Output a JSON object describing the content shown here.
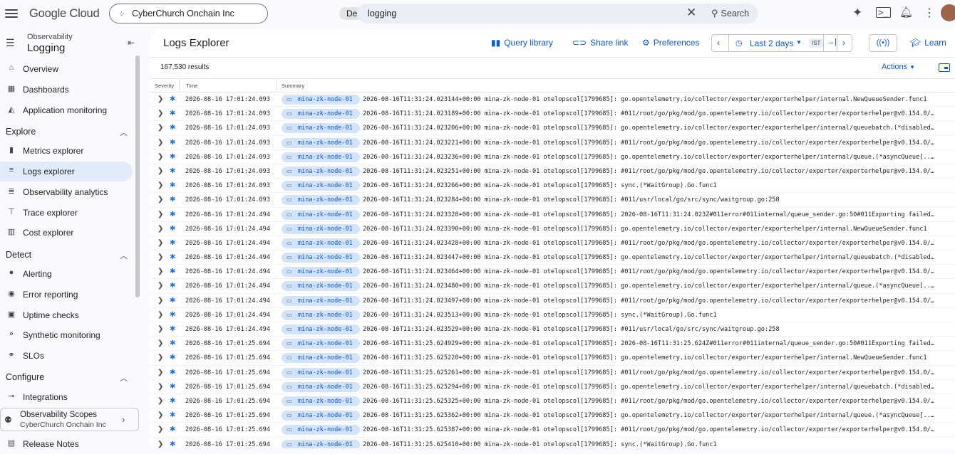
{
  "topbar": {
    "product": "Google Cloud",
    "project_name": "CyberChurch Onchain Inc",
    "project_env": "Dev",
    "search_value": "logging",
    "search_button": "Search"
  },
  "sidebar": {
    "subtitle": "Observability",
    "title": "Logging",
    "items_top": [
      {
        "label": "Overview",
        "icon": "home-icon"
      },
      {
        "label": "Dashboards",
        "icon": "dashboard-icon"
      },
      {
        "label": "Application monitoring",
        "icon": "app-monitoring-icon"
      }
    ],
    "explore_label": "Explore",
    "explore_items": [
      {
        "label": "Metrics explorer"
      },
      {
        "label": "Logs explorer"
      },
      {
        "label": "Observability analytics"
      },
      {
        "label": "Trace explorer"
      },
      {
        "label": "Cost explorer"
      }
    ],
    "detect_label": "Detect",
    "detect_items": [
      {
        "label": "Alerting"
      },
      {
        "label": "Error reporting"
      },
      {
        "label": "Uptime checks"
      },
      {
        "label": "Synthetic monitoring"
      },
      {
        "label": "SLOs"
      }
    ],
    "configure_label": "Configure",
    "configure_items": [
      {
        "label": "Integrations"
      }
    ],
    "scope_title": "Observability Scopes",
    "scope_sub": "CyberChurch Onchain Inc",
    "release_notes": "Release Notes"
  },
  "main": {
    "title": "Logs Explorer",
    "query_library": "Query library",
    "share_link": "Share link",
    "preferences": "Preferences",
    "time_range": "Last 2 days",
    "timezone": "IST",
    "learn": "Learn",
    "results": "167,530 results",
    "actions": "Actions",
    "col_severity": "Severity",
    "col_time": "Time",
    "col_summary": "Summary"
  },
  "logs": [
    {
      "time": "2026-08-16 17:01:24.093",
      "node": "mina-zk-node-01",
      "msg": "2026-08-16T11:31:24.023144+00:00 mina-zk-node-01 otelopscol[1799685]: go.opentelemetry.io/collector/exporter/exporterhelper/internal.NewQueueSender.func1"
    },
    {
      "time": "2026-08-16 17:01:24.093",
      "node": "mina-zk-node-01",
      "msg": "2026-08-16T11:31:24.023189+00:00 mina-zk-node-01 otelopscol[1799685]: #011/root/go/pkg/mod/go.opentelemetry.io/collector/exporter/exporterhelper@v0.154.0/…"
    },
    {
      "time": "2026-08-16 17:01:24.093",
      "node": "mina-zk-node-01",
      "msg": "2026-08-16T11:31:24.023206+00:00 mina-zk-node-01 otelopscol[1799685]: go.opentelemetry.io/collector/exporter/exporterhelper/internal/queuebatch.(*disabled…"
    },
    {
      "time": "2026-08-16 17:01:24.093",
      "node": "mina-zk-node-01",
      "msg": "2026-08-16T11:31:24.023221+00:00 mina-zk-node-01 otelopscol[1799685]: #011/root/go/pkg/mod/go.opentelemetry.io/collector/exporter/exporterhelper@v0.154.0/…"
    },
    {
      "time": "2026-08-16 17:01:24.093",
      "node": "mina-zk-node-01",
      "msg": "2026-08-16T11:31:24.023236+00:00 mina-zk-node-01 otelopscol[1799685]: go.opentelemetry.io/collector/exporter/exporterhelper/internal/queue.(*asyncQueue[..…"
    },
    {
      "time": "2026-08-16 17:01:24.093",
      "node": "mina-zk-node-01",
      "msg": "2026-08-16T11:31:24.023251+00:00 mina-zk-node-01 otelopscol[1799685]: #011/root/go/pkg/mod/go.opentelemetry.io/collector/exporter/exporterhelper@v0.154.0/…"
    },
    {
      "time": "2026-08-16 17:01:24.093",
      "node": "mina-zk-node-01",
      "msg": "2026-08-16T11:31:24.023266+00:00 mina-zk-node-01 otelopscol[1799685]: sync.(*WaitGroup).Go.func1"
    },
    {
      "time": "2026-08-16 17:01:24.093",
      "node": "mina-zk-node-01",
      "msg": "2026-08-16T11:31:24.023284+00:00 mina-zk-node-01 otelopscol[1799685]: #011/usr/local/go/src/sync/waitgroup.go:258"
    },
    {
      "time": "2026-08-16 17:01:24.494",
      "node": "mina-zk-node-01",
      "msg": "2026-08-16T11:31:24.023328+00:00 mina-zk-node-01 otelopscol[1799685]: 2026-08-16T11:31:24.023Z#011error#011internal/queue_sender.go:50#011Exporting failed…"
    },
    {
      "time": "2026-08-16 17:01:24.494",
      "node": "mina-zk-node-01",
      "msg": "2026-08-16T11:31:24.023390+00:00 mina-zk-node-01 otelopscol[1799685]: go.opentelemetry.io/collector/exporter/exporterhelper/internal.NewQueueSender.func1"
    },
    {
      "time": "2026-08-16 17:01:24.494",
      "node": "mina-zk-node-01",
      "msg": "2026-08-16T11:31:24.023428+00:00 mina-zk-node-01 otelopscol[1799685]: #011/root/go/pkg/mod/go.opentelemetry.io/collector/exporter/exporterhelper@v0.154.0/…"
    },
    {
      "time": "2026-08-16 17:01:24.494",
      "node": "mina-zk-node-01",
      "msg": "2026-08-16T11:31:24.023447+00:00 mina-zk-node-01 otelopscol[1799685]: go.opentelemetry.io/collector/exporter/exporterhelper/internal/queuebatch.(*disabled…"
    },
    {
      "time": "2026-08-16 17:01:24.494",
      "node": "mina-zk-node-01",
      "msg": "2026-08-16T11:31:24.023464+00:00 mina-zk-node-01 otelopscol[1799685]: #011/root/go/pkg/mod/go.opentelemetry.io/collector/exporter/exporterhelper@v0.154.0/…"
    },
    {
      "time": "2026-08-16 17:01:24.494",
      "node": "mina-zk-node-01",
      "msg": "2026-08-16T11:31:24.023480+00:00 mina-zk-node-01 otelopscol[1799685]: go.opentelemetry.io/collector/exporter/exporterhelper/internal/queue.(*asyncQueue[..…"
    },
    {
      "time": "2026-08-16 17:01:24.494",
      "node": "mina-zk-node-01",
      "msg": "2026-08-16T11:31:24.023497+00:00 mina-zk-node-01 otelopscol[1799685]: #011/root/go/pkg/mod/go.opentelemetry.io/collector/exporter/exporterhelper@v0.154.0/…"
    },
    {
      "time": "2026-08-16 17:01:24.494",
      "node": "mina-zk-node-01",
      "msg": "2026-08-16T11:31:24.023513+00:00 mina-zk-node-01 otelopscol[1799685]: sync.(*WaitGroup).Go.func1"
    },
    {
      "time": "2026-08-16 17:01:24.494",
      "node": "mina-zk-node-01",
      "msg": "2026-08-16T11:31:24.023529+00:00 mina-zk-node-01 otelopscol[1799685]: #011/usr/local/go/src/sync/waitgroup.go:258"
    },
    {
      "time": "2026-08-16 17:01:25.694",
      "node": "mina-zk-node-01",
      "msg": "2026-08-16T11:31:25.624929+00:00 mina-zk-node-01 otelopscol[1799685]: 2026-08-16T11:31:25.624Z#011error#011internal/queue_sender.go:50#011Exporting failed…"
    },
    {
      "time": "2026-08-16 17:01:25.694",
      "node": "mina-zk-node-01",
      "msg": "2026-08-16T11:31:25.625220+00:00 mina-zk-node-01 otelopscol[1799685]: go.opentelemetry.io/collector/exporter/exporterhelper/internal.NewQueueSender.func1"
    },
    {
      "time": "2026-08-16 17:01:25.694",
      "node": "mina-zk-node-01",
      "msg": "2026-08-16T11:31:25.625261+00:00 mina-zk-node-01 otelopscol[1799685]: #011/root/go/pkg/mod/go.opentelemetry.io/collector/exporter/exporterhelper@v0.154.0/…"
    },
    {
      "time": "2026-08-16 17:01:25.694",
      "node": "mina-zk-node-01",
      "msg": "2026-08-16T11:31:25.625294+00:00 mina-zk-node-01 otelopscol[1799685]: go.opentelemetry.io/collector/exporter/exporterhelper/internal/queuebatch.(*disabled…"
    },
    {
      "time": "2026-08-16 17:01:25.694",
      "node": "mina-zk-node-01",
      "msg": "2026-08-16T11:31:25.625325+00:00 mina-zk-node-01 otelopscol[1799685]: #011/root/go/pkg/mod/go.opentelemetry.io/collector/exporter/exporterhelper@v0.154.0/…"
    },
    {
      "time": "2026-08-16 17:01:25.694",
      "node": "mina-zk-node-01",
      "msg": "2026-08-16T11:31:25.625362+00:00 mina-zk-node-01 otelopscol[1799685]: go.opentelemetry.io/collector/exporter/exporterhelper/internal/queue.(*asyncQueue[..…"
    },
    {
      "time": "2026-08-16 17:01:25.694",
      "node": "mina-zk-node-01",
      "msg": "2026-08-16T11:31:25.625387+00:00 mina-zk-node-01 otelopscol[1799685]: #011/root/go/pkg/mod/go.opentelemetry.io/collector/exporter/exporterhelper@v0.154.0/…"
    },
    {
      "time": "2026-08-16 17:01:25.694",
      "node": "mina-zk-node-01",
      "msg": "2026-08-16T11:31:25.625410+00:00 mina-zk-node-01 otelopscol[1799685]: sync.(*WaitGroup).Go.func1"
    }
  ]
}
